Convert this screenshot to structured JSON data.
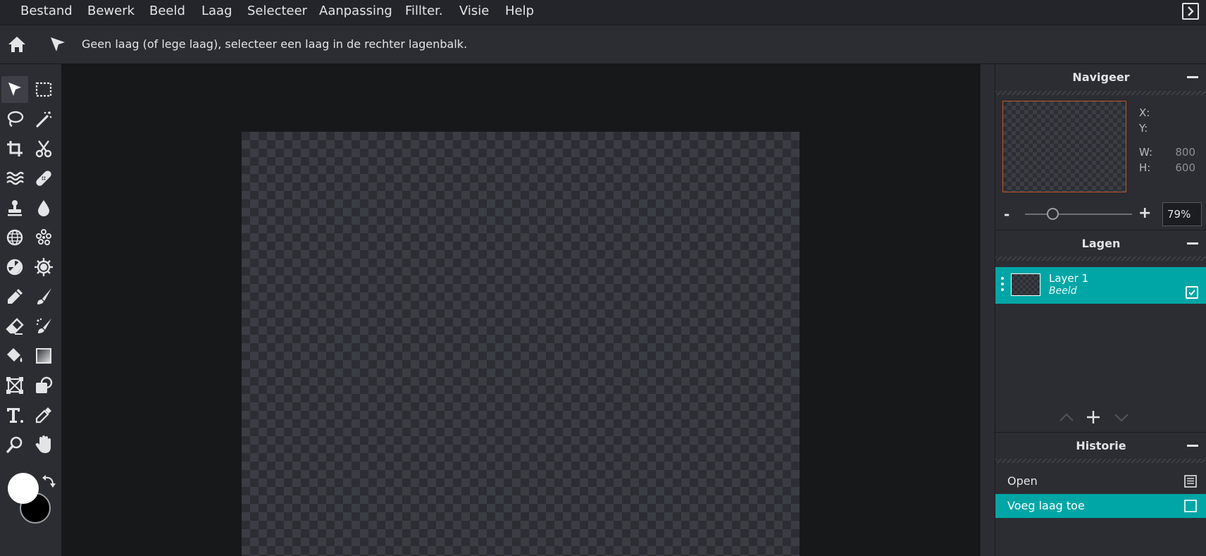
{
  "menu": {
    "items": [
      "Bestand",
      "Bewerk",
      "Beeld",
      "Laag",
      "Selecteer",
      "Aanpassing",
      "Fillter.",
      "Visie",
      "Help"
    ]
  },
  "options": {
    "hint": "Geen laag (of lege laag), selecteer een laag in de rechter lagenbalk."
  },
  "colors": {
    "foreground": "#ffffff",
    "background": "#000000",
    "accent": "#00a6a6",
    "navigator_frame": "#c1542b"
  },
  "tools": [
    "move-icon",
    "rect-select-icon",
    "lasso-icon",
    "magic-wand-icon",
    "crop-icon",
    "scissors-icon",
    "wave-icon",
    "bandage-icon",
    "stamp-icon",
    "drop-icon",
    "sphere-icon",
    "dots-icon",
    "contrast-icon",
    "gear-sun-icon",
    "pencil-icon",
    "brush-icon",
    "eraser-icon",
    "spray-brush-icon",
    "bucket-icon",
    "gradient-icon",
    "transform-icon",
    "clone-icon",
    "text-icon",
    "eyedropper-icon",
    "zoom-icon",
    "hand-icon"
  ],
  "navigator": {
    "title": "Navigeer",
    "x_label": "X:",
    "y_label": "Y:",
    "w_label": "W:",
    "h_label": "H:",
    "x_value": "",
    "y_value": "",
    "w_value": "800",
    "h_value": "600",
    "zoom_minus": "-",
    "zoom_plus": "+",
    "zoom_value": "79%",
    "zoom_slider_position": 0.26
  },
  "layers": {
    "title": "Lagen",
    "items": [
      {
        "name": "Layer 1",
        "type": "Beeld",
        "visible": true
      }
    ]
  },
  "history": {
    "title": "Historie",
    "items": [
      {
        "label": "Open",
        "icon": "document-icon"
      },
      {
        "label": "Voeg laag toe",
        "icon": "square-icon"
      }
    ]
  }
}
